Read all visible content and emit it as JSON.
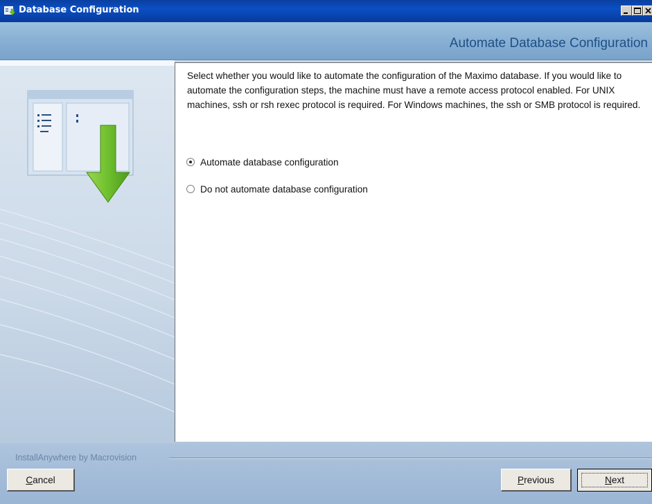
{
  "window": {
    "title": "Database Configuration",
    "icon": "installer-app-icon"
  },
  "header": {
    "step_title": "Automate Database Configuration"
  },
  "content": {
    "description": "Select whether you would like to automate the configuration of the Maximo database. If you would like to automate the configuration steps, the machine must have a remote access protocol enabled. For UNIX machines, ssh or rsh rexec protocol is required. For Windows machines, the ssh or SMB protocol is required.",
    "options": [
      {
        "label": "Automate database configuration",
        "selected": true
      },
      {
        "label": "Do not automate database configuration",
        "selected": false
      }
    ]
  },
  "footer": {
    "brand": "InstallAnywhere by Macrovision",
    "cancel_label": "Cancel",
    "previous_label": "Previous",
    "next_label": "Next"
  },
  "colors": {
    "title_bar": "#0b4fc4",
    "header_band": "#86aed3",
    "step_title_text": "#1e4f85",
    "arrow_green": "#6fbf2e"
  }
}
